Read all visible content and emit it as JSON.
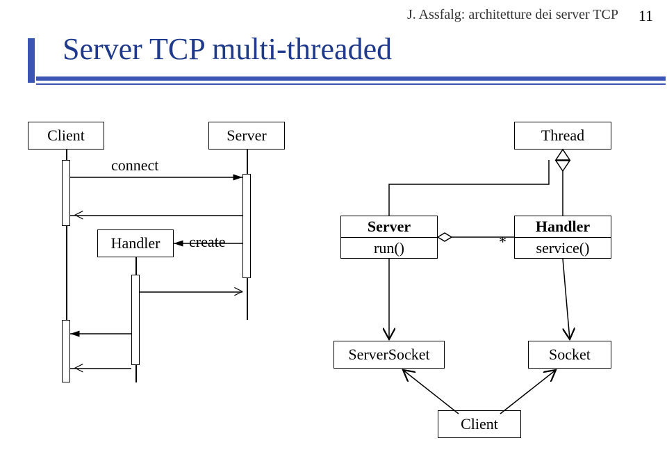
{
  "header": {
    "text": "J. Assfalg: architetture dei server TCP",
    "pageNumber": "11"
  },
  "title": "Server TCP multi-threaded",
  "sequence": {
    "client": "Client",
    "server": "Server",
    "handler": "Handler",
    "connectLabel": "connect",
    "createLabel": "create"
  },
  "classDiagram": {
    "threadBox": "Thread",
    "serverBox": {
      "name": "Server",
      "op": "run()"
    },
    "handlerBox": {
      "name": "Handler",
      "op": "service()"
    },
    "serverSocket": "ServerSocket",
    "socket": "Socket",
    "clientBox": "Client",
    "multiplicity": "*"
  }
}
